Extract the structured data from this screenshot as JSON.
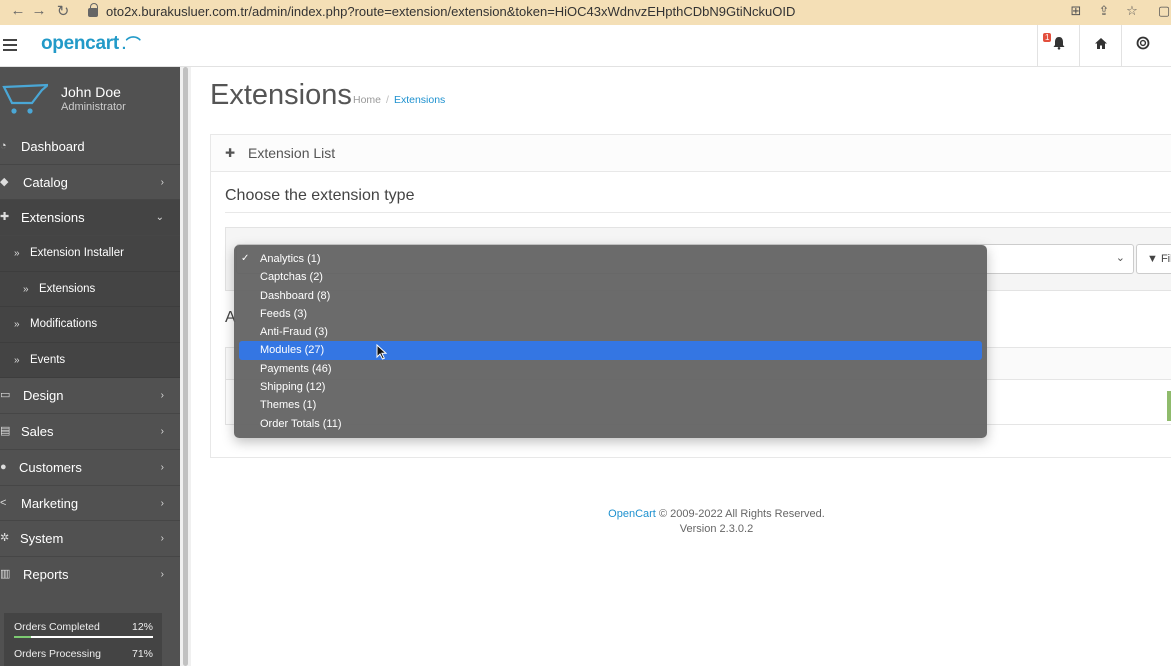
{
  "browser": {
    "url": "oto2x.burakusluer.com.tr/admin/index.php?route=extension/extension&token=HiOC43xWdnvzEHpthCDbN9GtiNckuOID"
  },
  "header": {
    "logo_text": "opencart",
    "notification_count": "1"
  },
  "profile": {
    "name": "John Doe",
    "role": "Administrator"
  },
  "sidebar": {
    "items": [
      {
        "label": "Dashboard",
        "icon": "dashboard-icon"
      },
      {
        "label": "Catalog",
        "icon": "tag-icon"
      },
      {
        "label": "Extensions",
        "icon": "puzzle-icon"
      },
      {
        "label": "Design",
        "icon": "monitor-icon"
      },
      {
        "label": "Sales",
        "icon": "cart-icon"
      },
      {
        "label": "Customers",
        "icon": "user-icon"
      },
      {
        "label": "Marketing",
        "icon": "share-icon"
      },
      {
        "label": "System",
        "icon": "cog-icon"
      },
      {
        "label": "Reports",
        "icon": "bar-chart-icon"
      }
    ],
    "extensions_sub": [
      {
        "label": "Extension Installer"
      },
      {
        "label": "Extensions"
      },
      {
        "label": "Modifications"
      },
      {
        "label": "Events"
      }
    ],
    "stats": [
      {
        "label": "Orders Completed",
        "percent": "12%",
        "value": 12
      },
      {
        "label": "Orders Processing",
        "percent": "71%",
        "value": 71
      }
    ]
  },
  "page": {
    "title": "Extensions",
    "breadcrumb": [
      "Home",
      "Extensions"
    ],
    "panel_title": "Extension List",
    "choose_title": "Choose the extension type",
    "filter_label": "Filt",
    "sub_heading_partial": "A"
  },
  "dropdown": {
    "options": [
      {
        "label": "Analytics (1)",
        "checked": true
      },
      {
        "label": "Captchas (2)"
      },
      {
        "label": "Dashboard (8)"
      },
      {
        "label": "Feeds (3)"
      },
      {
        "label": "Anti-Fraud (3)"
      },
      {
        "label": "Modules (27)",
        "highlighted": true
      },
      {
        "label": "Payments (46)"
      },
      {
        "label": "Shipping (12)"
      },
      {
        "label": "Themes (1)"
      },
      {
        "label": "Order Totals (11)"
      }
    ],
    "highlight_color": "#3476e3"
  },
  "footer": {
    "brand": "OpenCart",
    "copyright": "© 2009-2022 All Rights Reserved.",
    "version": "Version 2.3.0.2"
  },
  "colors": {
    "brand_blue": "#1e91cf",
    "sidebar_bg": "#515151",
    "browser_bar": "#f4dfb6"
  }
}
